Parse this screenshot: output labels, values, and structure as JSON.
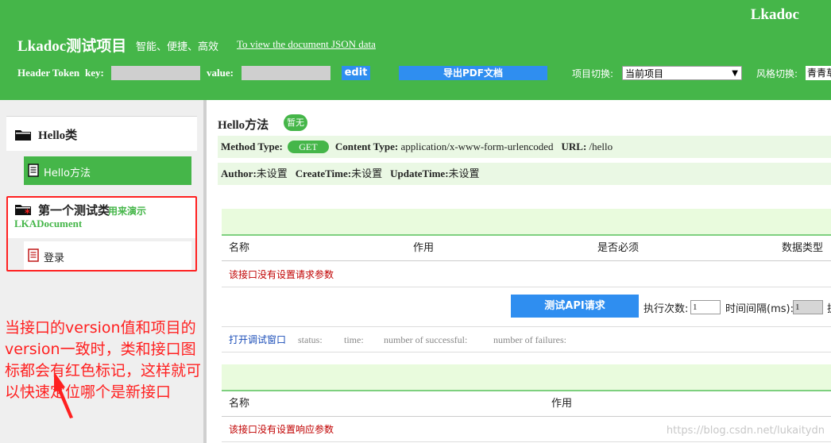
{
  "header": {
    "brand": "Lkadoc",
    "project_title": "Lkadoc测试项目",
    "project_desc": "智能、便捷、高效",
    "json_link": "To view the document JSON data",
    "token_label": "Header Token",
    "key_label": "key:",
    "key_value": "",
    "value_label": "value:",
    "value_value": "",
    "edit_label": "edit",
    "pdf_label": "导出PDF文档",
    "project_switch_label": "项目切换:",
    "project_switch_value": "当前项目",
    "style_switch_label": "风格切换:",
    "style_switch_value": "青青草原"
  },
  "sidebar": {
    "classes": [
      {
        "name": "Hello类",
        "methods": [
          {
            "name": "Hello方法",
            "active": true
          }
        ]
      },
      {
        "name": "第一个测试类",
        "desc": "用来演示",
        "desc2": "LKADocument",
        "highlighted": true,
        "methods": [
          {
            "name": "登录",
            "active": false,
            "highlighted": true
          }
        ]
      }
    ],
    "annotation": "当接口的version值和项目的version一致时，类和接口图标都会有红色标记，这样就可以快速定位哪个是新接口"
  },
  "main": {
    "method_title": "Hello方法",
    "tag": "暂无",
    "method_type_label": "Method Type:",
    "method_type": "GET",
    "content_type_label": "Content Type:",
    "content_type": "application/x-www-form-urlencoded",
    "url_label": "URL:",
    "url": "/hello",
    "author_label": "Author:",
    "author": "未设置",
    "create_label": "CreateTime:",
    "create": "未设置",
    "update_label": "UpdateTime:",
    "update": "未设置",
    "request_table": {
      "headers": [
        "名称",
        "作用",
        "是否必须",
        "数据类型"
      ],
      "empty_text": "该接口没有设置请求参数"
    },
    "test": {
      "button": "测试API请求",
      "exec_label": "执行次数:",
      "exec_value": "1",
      "interval_label": "时间间隔(ms):",
      "interval_value": "1",
      "tail": "执"
    },
    "debug": {
      "link": "打开调试窗口",
      "status": "status:",
      "time": "time:",
      "success": "number of successful:",
      "failures": "number of failures:"
    },
    "response_table": {
      "headers": [
        "名称",
        "作用"
      ],
      "empty_text": "该接口没有设置响应参数"
    }
  },
  "watermark": "https://blog.csdn.net/lukaitydn",
  "colors": {
    "primary_green": "#45b649",
    "light_green": "#eaf8e4",
    "blue": "#2f8ef0",
    "red": "#ff2020"
  }
}
